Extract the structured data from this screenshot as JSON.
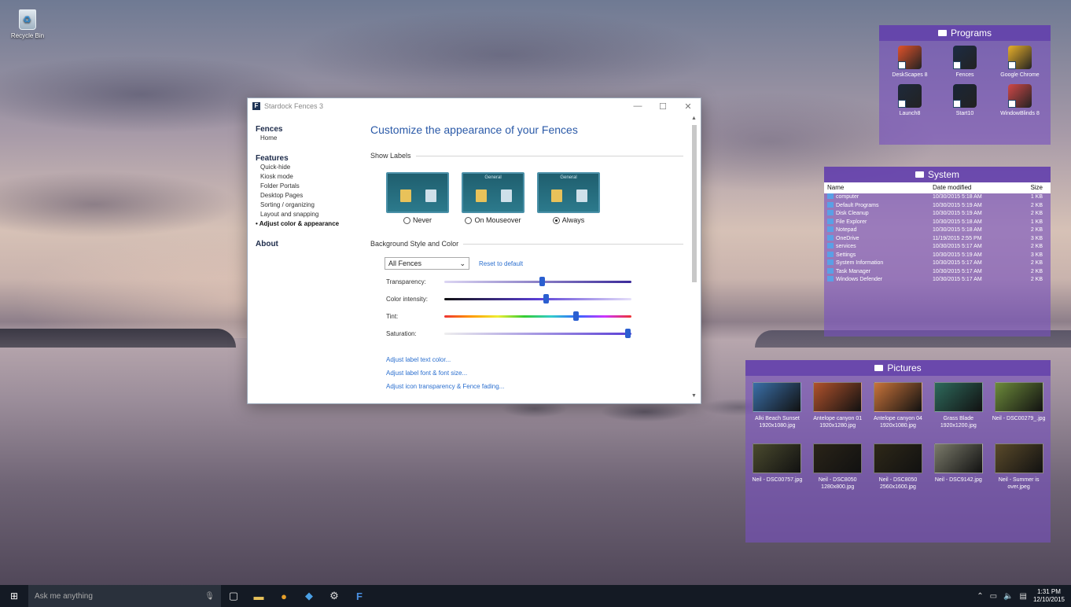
{
  "desktop": {
    "recycle_bin_label": "Recycle Bin"
  },
  "window": {
    "title": "Stardock Fences 3",
    "logo": "F",
    "controls": {
      "minimize": "—",
      "maximize": "☐",
      "close": "✕"
    }
  },
  "nav": {
    "fences_head": "Fences",
    "home": "Home",
    "features_head": "Features",
    "features": [
      "Quick-hide",
      "Kiosk mode",
      "Folder Portals",
      "Desktop Pages",
      "Sorting / organizing",
      "Layout and snapping",
      "• Adjust color & appearance"
    ],
    "about": "About"
  },
  "content": {
    "title": "Customize the appearance of your Fences",
    "show_labels": "Show Labels",
    "options": [
      {
        "label": "Never",
        "selected": false,
        "header": ""
      },
      {
        "label": "On Mouseover",
        "selected": false,
        "header": "General"
      },
      {
        "label": "Always",
        "selected": true,
        "header": "General"
      }
    ],
    "background_label": "Background Style and Color",
    "fence_select": "All Fences",
    "reset_link": "Reset to default",
    "sliders": [
      {
        "label": "Transparency:",
        "value": 0.52
      },
      {
        "label": "Color intensity:",
        "value": 0.54
      },
      {
        "label": "Tint:",
        "value": 0.7
      },
      {
        "label": "Saturation:",
        "value": 0.98
      }
    ],
    "links": [
      "Adjust label text color...",
      "Adjust label font & font size...",
      "Adjust icon transparency & Fence fading..."
    ]
  },
  "fence_programs": {
    "title": "Programs",
    "items": [
      {
        "label": "DeskScapes 8",
        "color": "#e0522a"
      },
      {
        "label": "Fences",
        "color": "#1c2c44"
      },
      {
        "label": "Google Chrome",
        "color": "#e8b02a"
      },
      {
        "label": "Launch8",
        "color": "#1e2a3c"
      },
      {
        "label": "Start10",
        "color": "#1a2536"
      },
      {
        "label": "WindowBlinds 8",
        "color": "#d04848"
      }
    ]
  },
  "fence_system": {
    "title": "System",
    "headers": {
      "name": "Name",
      "date": "Date modified",
      "size": "Size"
    },
    "rows": [
      {
        "name": "computer",
        "date": "10/30/2015 5:18 AM",
        "size": "1 KB"
      },
      {
        "name": "Default Programs",
        "date": "10/30/2015 5:19 AM",
        "size": "2 KB"
      },
      {
        "name": "Disk Cleanup",
        "date": "10/30/2015 5:19 AM",
        "size": "2 KB"
      },
      {
        "name": "File Explorer",
        "date": "10/30/2015 5:18 AM",
        "size": "1 KB"
      },
      {
        "name": "Notepad",
        "date": "10/30/2015 5:18 AM",
        "size": "2 KB"
      },
      {
        "name": "OneDrive",
        "date": "11/19/2015 2:55 PM",
        "size": "3 KB"
      },
      {
        "name": "services",
        "date": "10/30/2015 5:17 AM",
        "size": "2 KB"
      },
      {
        "name": "Settings",
        "date": "10/30/2015 5:19 AM",
        "size": "3 KB"
      },
      {
        "name": "System Information",
        "date": "10/30/2015 5:17 AM",
        "size": "2 KB"
      },
      {
        "name": "Task Manager",
        "date": "10/30/2015 5:17 AM",
        "size": "2 KB"
      },
      {
        "name": "Windows Defender",
        "date": "10/30/2015 5:17 AM",
        "size": "2 KB"
      }
    ]
  },
  "fence_pictures": {
    "title": "Pictures",
    "items": [
      {
        "label": "Alki Beach Sunset 1920x1080.jpg",
        "color": "#3a6fa8"
      },
      {
        "label": "Antelope canyon 01 1920x1280.jpg",
        "color": "#b0522c"
      },
      {
        "label": "Antelope canyon 04 1920x1080.jpg",
        "color": "#c8733a"
      },
      {
        "label": "Grass Blade 1920x1200.jpg",
        "color": "#2e6a5c"
      },
      {
        "label": "Neil - DSC00279_.jpg",
        "color": "#6c8a3a"
      },
      {
        "label": "Neil - DSC00757.jpg",
        "color": "#4a4a2e"
      },
      {
        "label": "Neil - DSC8050 1280x800.jpg",
        "color": "#2a2418"
      },
      {
        "label": "Neil - DSC8050 2560x1600.jpg",
        "color": "#2e2818"
      },
      {
        "label": "Neil - DSC9142.jpg",
        "color": "#7a7a6a"
      },
      {
        "label": "Neil - Summer is over.jpeg",
        "color": "#5a4a2a"
      }
    ]
  },
  "taskbar": {
    "search_placeholder": "Ask me anything",
    "time": "1:31 PM",
    "date": "12/10/2015"
  }
}
